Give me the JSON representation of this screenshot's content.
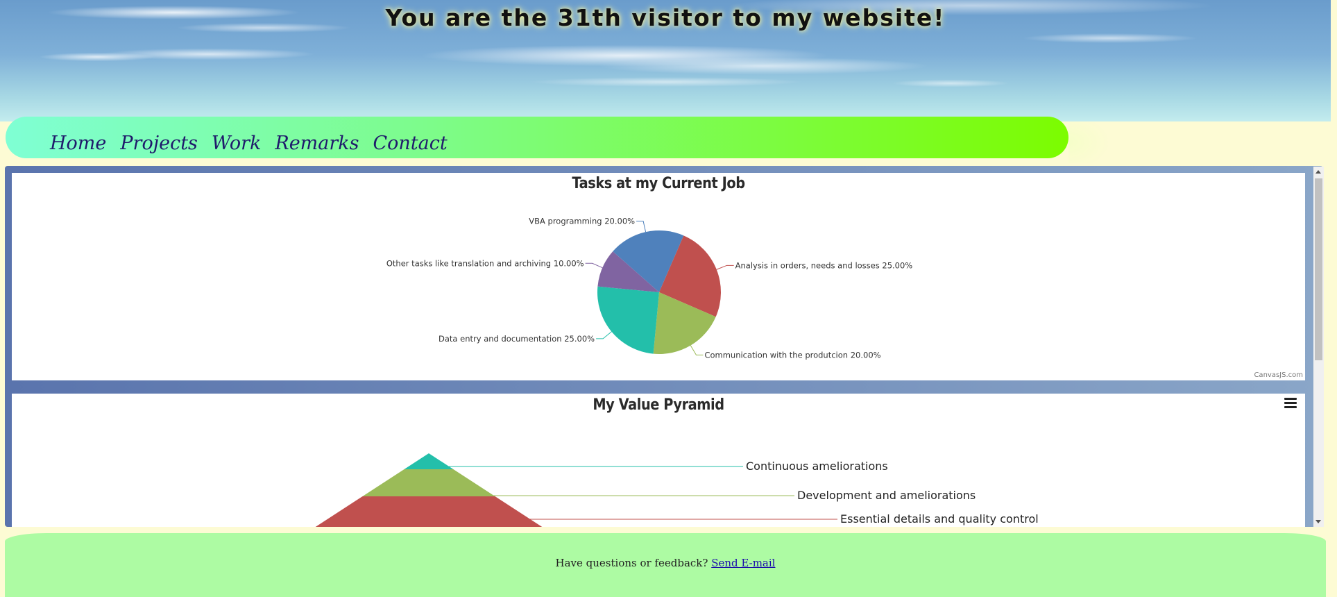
{
  "header": {
    "title": "You are the 31th visitor to my website!"
  },
  "nav": {
    "items": [
      "Home",
      "Projects",
      "Work",
      "Remarks",
      "Contact"
    ]
  },
  "charts": {
    "pie_title": "Tasks at my Current Job",
    "pyramid_title": "My Value Pyramid",
    "credit": "CanvasJS.com",
    "menu_icon": "hamburger-menu-icon"
  },
  "chart_data": [
    {
      "type": "pie",
      "title": "Tasks at my Current Job",
      "slices": [
        {
          "label": "VBA programming",
          "value": 20,
          "display": "VBA programming 20.00%",
          "color": "#4f81bc"
        },
        {
          "label": "Analysis in orders, needs and losses",
          "value": 25,
          "display": "Analysis in orders, needs and losses 25.00%",
          "color": "#c0504e"
        },
        {
          "label": "Communication with the produtcion",
          "value": 20,
          "display": "Communication with the produtcion 20.00%",
          "color": "#9bbb58"
        },
        {
          "label": "Data entry and documentation",
          "value": 25,
          "display": "Data entry and documentation 25.00%",
          "color": "#23bfaa"
        },
        {
          "label": "Other tasks like translation and archiving",
          "value": 10,
          "display": "Other tasks like translation and archiving 10.00%",
          "color": "#8064a1"
        }
      ]
    },
    {
      "type": "pyramid",
      "title": "My Value Pyramid",
      "levels": [
        {
          "label": "Continuous ameliorations",
          "color": "#23bfaa"
        },
        {
          "label": "Development and ameliorations",
          "color": "#9bbb58"
        },
        {
          "label": "Essential details and quality control",
          "color": "#c0504e"
        }
      ]
    }
  ],
  "footer": {
    "text": "Have questions or feedback?",
    "link": "Send E-mail"
  }
}
